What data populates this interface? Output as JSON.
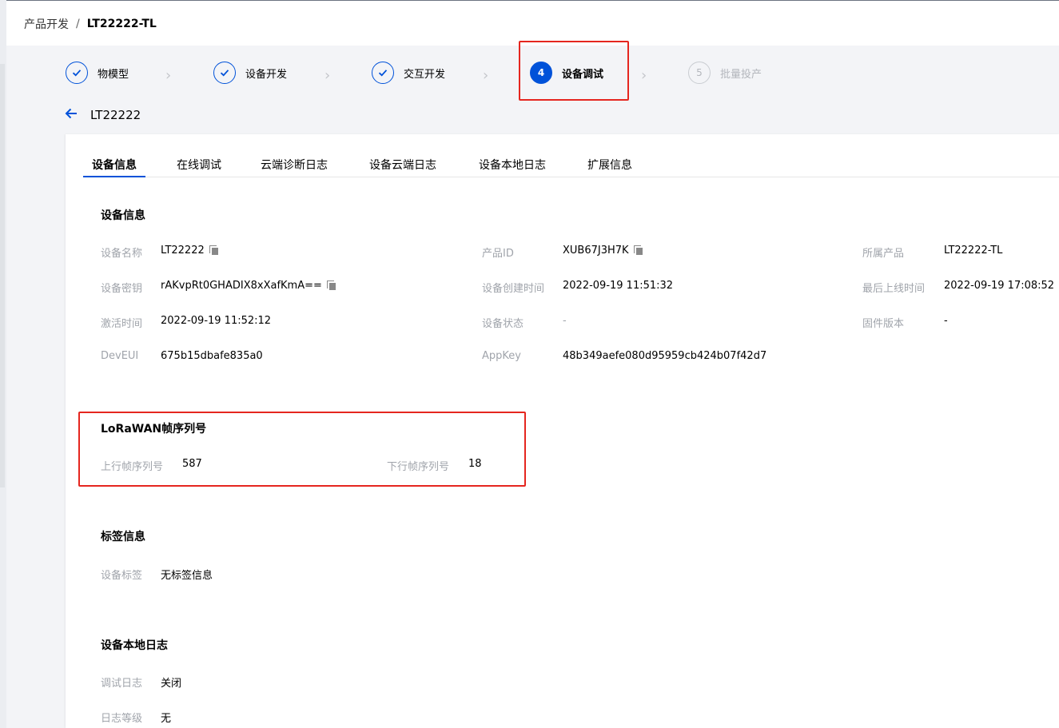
{
  "breadcrumb": {
    "parent": "产品开发",
    "sep": "/",
    "current": "LT22222-TL"
  },
  "steps": [
    {
      "label": "物模型",
      "status": "done"
    },
    {
      "label": "设备开发",
      "status": "done"
    },
    {
      "label": "交互开发",
      "status": "done"
    },
    {
      "label": "设备调试",
      "status": "active",
      "number": "4"
    },
    {
      "label": "批量投产",
      "status": "pending",
      "number": "5"
    }
  ],
  "device_title": "LT22222",
  "tabs": [
    "设备信息",
    "在线调试",
    "云端诊断日志",
    "设备云端日志",
    "设备本地日志",
    "扩展信息"
  ],
  "device_info": {
    "title": "设备信息",
    "fields": [
      {
        "label": "设备名称",
        "value": "LT22222"
      },
      {
        "label": "产品ID",
        "value": "XUB67J3H7K"
      },
      {
        "label": "所属产品",
        "value": "LT22222-TL"
      },
      {
        "label": "设备密钥",
        "value": "rAKvpRt0GHADIX8xXafKmA=="
      },
      {
        "label": "设备创建时间",
        "value": "2022-09-19 11:51:32"
      },
      {
        "label": "最后上线时间",
        "value": "2022-09-19 17:08:52"
      },
      {
        "label": "激活时间",
        "value": "2022-09-19 11:52:12"
      },
      {
        "label": "设备状态",
        "value": "-"
      },
      {
        "label": "固件版本",
        "value": "-"
      },
      {
        "label": "DevEUI",
        "value": "675b15dbafe835a0"
      },
      {
        "label": "AppKey",
        "value": "48b349aefe080d95959cb424b07f42d7"
      }
    ]
  },
  "lorawan": {
    "title": "LoRaWAN帧序列号",
    "uplink_label": "上行帧序列号",
    "uplink_value": "587",
    "downlink_label": "下行帧序列号",
    "downlink_value": "18"
  },
  "tags": {
    "title": "标签信息",
    "label": "设备标签",
    "value": "无标签信息"
  },
  "local_log": {
    "title": "设备本地日志",
    "debug_label": "调试日志",
    "debug_value": "关闭",
    "level_label": "日志等级",
    "level_value": "无"
  },
  "colors": {
    "primary": "#0052d9",
    "highlight": "#e5261f"
  }
}
